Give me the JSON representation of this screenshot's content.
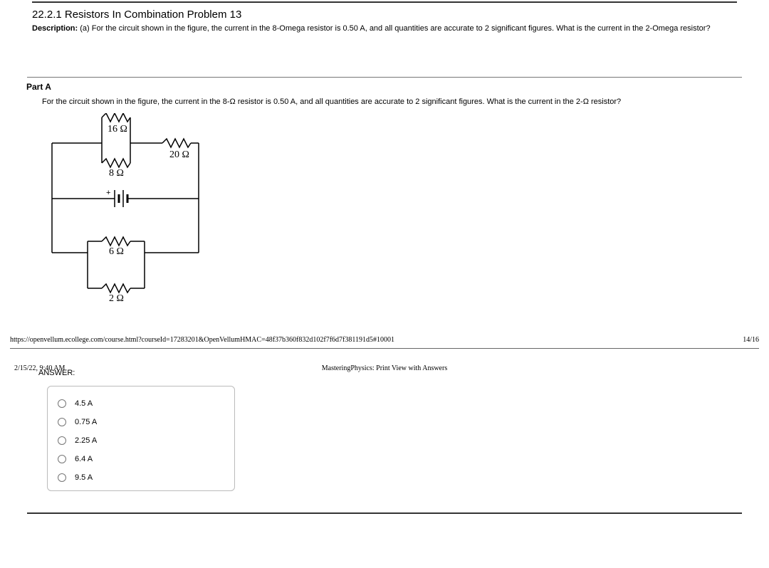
{
  "header": {
    "title": "22.2.1 Resistors In Combination Problem 13",
    "desc_label": "Description:",
    "desc_text": " (a) For the circuit shown in the figure, the current in the 8-Omega resistor is 0.50 A, and all quantities are accurate to 2 significant figures. What is the current in the 2-Omega resistor?"
  },
  "part": {
    "label": "Part A",
    "question_pre": "For the circuit shown in the figure, the current in the 8-",
    "omega": "Ω",
    "question_mid": " resistor is 0.50 A, and all quantities are accurate to 2 significant figures. What is the current in the 2-",
    "question_post": " resistor?"
  },
  "circuit": {
    "r16": "16 Ω",
    "r20": "20 Ω",
    "r8": "8 Ω",
    "r6": "6 Ω",
    "r2": "2 Ω"
  },
  "footer": {
    "url": "https://openvellum.ecollege.com/course.html?courseId=17283201&OpenVellumHMAC=48f37b360f832d102f7f6d7f381191d5#10001",
    "page": "14/16"
  },
  "meta": {
    "date": "2/15/22, 9:40 AM",
    "center": "MasteringPhysics: Print View with Answers"
  },
  "answer": {
    "label": "ANSWER:",
    "options": [
      "4.5 A",
      "0.75 A",
      "2.25 A",
      "6.4 A",
      "9.5 A"
    ]
  }
}
